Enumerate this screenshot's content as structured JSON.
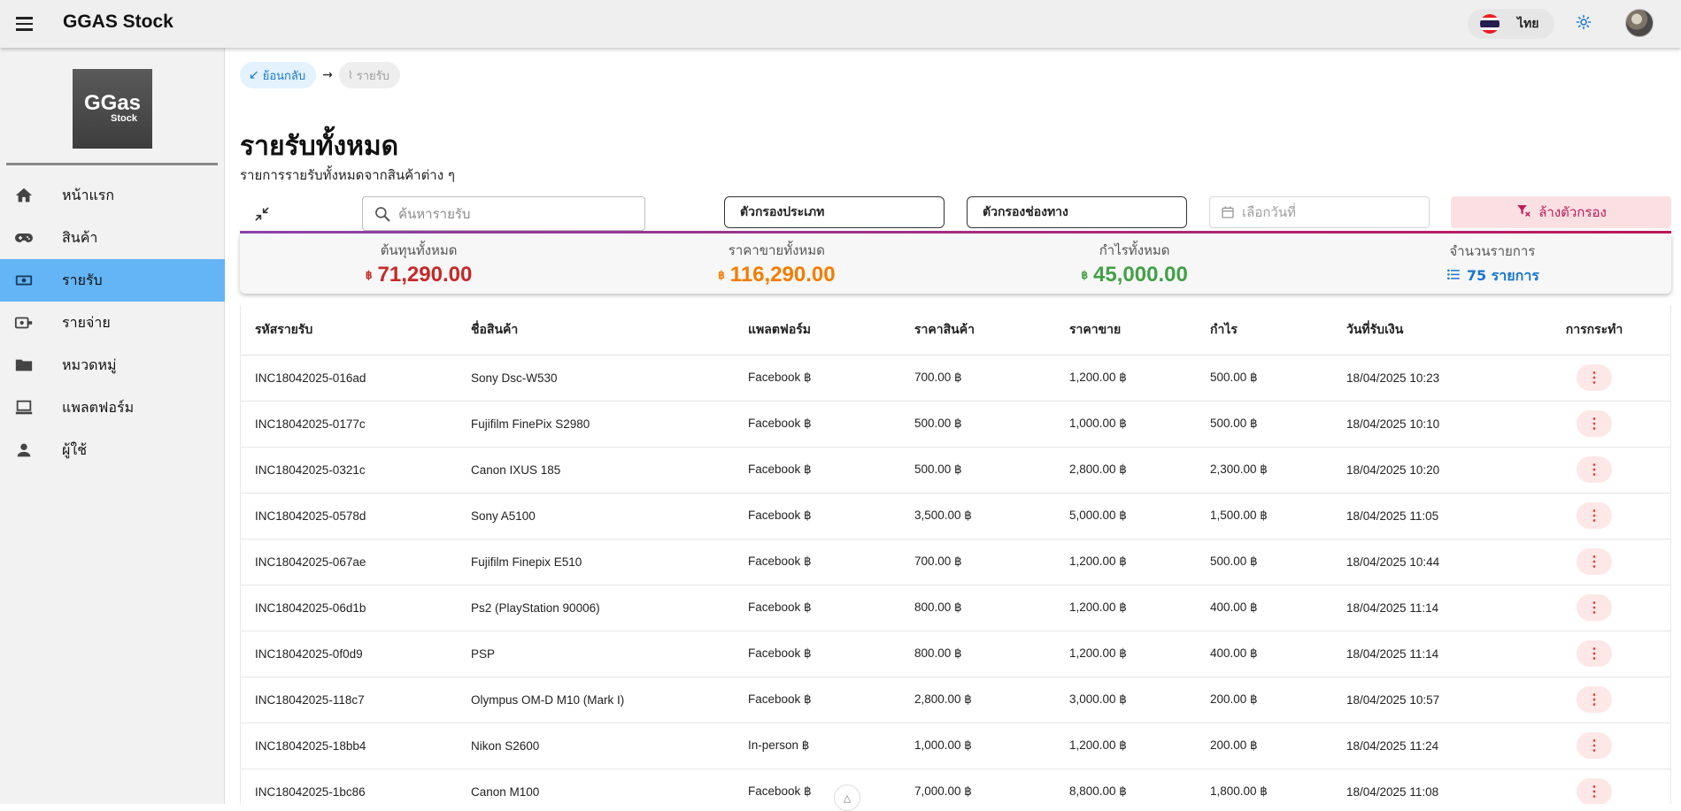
{
  "app": {
    "title": "GGAS Stock"
  },
  "topbar": {
    "language_label": "ไทย",
    "flag_colors": [
      "#ED1C24",
      "#FFFFFF",
      "#241D4F",
      "#FFFFFF",
      "#ED1C24"
    ],
    "theme_icon": "sun-icon",
    "avatar_icon": "user-avatar"
  },
  "sidebar": {
    "logo_line1": "GGas",
    "logo_line2": "Stock",
    "items": [
      {
        "label": "หน้าแรก",
        "icon": "home-icon",
        "active": false
      },
      {
        "label": "สินค้า",
        "icon": "gamepad-icon",
        "active": false
      },
      {
        "label": "รายรับ",
        "icon": "money-icon",
        "active": true
      },
      {
        "label": "รายจ่าย",
        "icon": "money-off-icon",
        "active": false
      },
      {
        "label": "หมวดหมู่",
        "icon": "folder-icon",
        "active": false
      },
      {
        "label": "แพลตฟอร์ม",
        "icon": "laptop-icon",
        "active": false
      },
      {
        "label": "ผู้ใช้",
        "icon": "person-icon",
        "active": false
      }
    ]
  },
  "breadcrumb": {
    "back_label": "ย้อนกลับ",
    "current_label": "รายรับ"
  },
  "page": {
    "title": "รายรับทั้งหมด",
    "subtitle": "รายการรายรับทั้งหมดจากสินค้าต่าง ๆ"
  },
  "filters": {
    "search_placeholder": "ค้นหารายรับ",
    "type_filter": "ตัวกรองประเภท",
    "channel_filter": "ตัวกรองช่องทาง",
    "date_placeholder": "เลือกวันที่",
    "clear_label": "ล้างตัวกรอง"
  },
  "summary": {
    "currency_symbol": "฿",
    "cost_label": "ต้นทุนทั้งหมด",
    "cost_value": "71,290.00",
    "cost_color": "#c62828",
    "sales_label": "ราคาขายทั้งหมด",
    "sales_value": "116,290.00",
    "sales_color": "#f57c00",
    "profit_label": "กำไรทั้งหมด",
    "profit_value": "45,000.00",
    "profit_color": "#43a047",
    "count_label": "จำนวนรายการ",
    "count_value": "75 รายการ",
    "count_color": "#1976d2"
  },
  "table": {
    "headers": [
      "รหัสรายรับ",
      "ชื่อสินค้า",
      "แพลตฟอร์ม",
      "ราคาสินค้า",
      "ราคาขาย",
      "กำไร",
      "วันที่รับเงิน",
      "การกระทำ"
    ],
    "action_label": "⋮",
    "rows": [
      {
        "id": "INC18042025-016ad",
        "product": "Sony Dsc-W530",
        "platform": "Facebook ฿",
        "cost": "700.00 ฿",
        "price": "1,200.00 ฿",
        "profit": "500.00 ฿",
        "date": "18/04/2025 10:23"
      },
      {
        "id": "INC18042025-0177c",
        "product": "Fujifilm FinePix S2980",
        "platform": "Facebook ฿",
        "cost": "500.00 ฿",
        "price": "1,000.00 ฿",
        "profit": "500.00 ฿",
        "date": "18/04/2025 10:10"
      },
      {
        "id": "INC18042025-0321c",
        "product": "Canon IXUS 185",
        "platform": "Facebook ฿",
        "cost": "500.00 ฿",
        "price": "2,800.00 ฿",
        "profit": "2,300.00 ฿",
        "date": "18/04/2025 10:20"
      },
      {
        "id": "INC18042025-0578d",
        "product": "Sony A5100",
        "platform": "Facebook ฿",
        "cost": "3,500.00 ฿",
        "price": "5,000.00 ฿",
        "profit": "1,500.00 ฿",
        "date": "18/04/2025 11:05"
      },
      {
        "id": "INC18042025-067ae",
        "product": "Fujifilm Finepix E510",
        "platform": "Facebook ฿",
        "cost": "700.00 ฿",
        "price": "1,200.00 ฿",
        "profit": "500.00 ฿",
        "date": "18/04/2025 10:44"
      },
      {
        "id": "INC18042025-06d1b",
        "product": "Ps2 (PlayStation 90006)",
        "platform": "Facebook ฿",
        "cost": "800.00 ฿",
        "price": "1,200.00 ฿",
        "profit": "400.00 ฿",
        "date": "18/04/2025 11:14"
      },
      {
        "id": "INC18042025-0f0d9",
        "product": "PSP",
        "platform": "Facebook ฿",
        "cost": "800.00 ฿",
        "price": "1,200.00 ฿",
        "profit": "400.00 ฿",
        "date": "18/04/2025 11:14"
      },
      {
        "id": "INC18042025-118c7",
        "product": "Olympus OM-D M10 (Mark I)",
        "platform": "Facebook ฿",
        "cost": "2,800.00 ฿",
        "price": "3,000.00 ฿",
        "profit": "200.00 ฿",
        "date": "18/04/2025 10:57"
      },
      {
        "id": "INC18042025-18bb4",
        "product": "Nikon S2600",
        "platform": "In-person ฿",
        "cost": "1,000.00 ฿",
        "price": "1,200.00 ฿",
        "profit": "200.00 ฿",
        "date": "18/04/2025 11:24"
      },
      {
        "id": "INC18042025-1bc86",
        "product": "Canon M100",
        "platform": "Facebook ฿",
        "cost": "7,000.00 ฿",
        "price": "8,800.00 ฿",
        "profit": "1,800.00 ฿",
        "date": "18/04/2025 11:08"
      }
    ]
  }
}
